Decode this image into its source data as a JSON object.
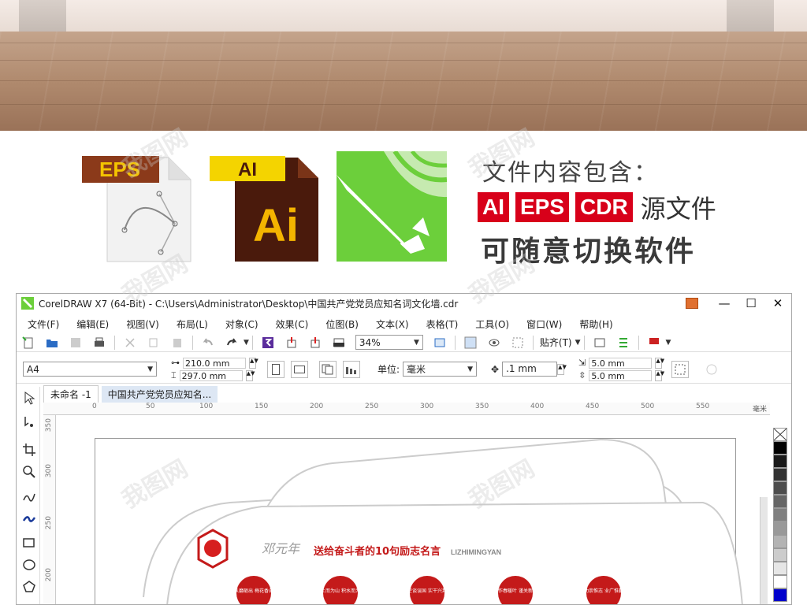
{
  "info": {
    "title": "文件内容包含：",
    "formats": [
      "AI",
      "EPS",
      "CDR"
    ],
    "formats_suffix": "源文件",
    "subtitle": "可随意切换软件",
    "eps_icon_label": "EPS",
    "ai_icon_tab": "AI",
    "ai_icon_main": "Ai"
  },
  "window": {
    "title": "CorelDRAW X7 (64-Bit) - C:\\Users\\Administrator\\Desktop\\中国共产党党员应知名词文化墙.cdr",
    "controls": {
      "minimize": "—",
      "maximize": "☐",
      "close": "✕"
    }
  },
  "menu": [
    "文件(F)",
    "编辑(E)",
    "视图(V)",
    "布局(L)",
    "对象(C)",
    "效果(C)",
    "位图(B)",
    "文本(X)",
    "表格(T)",
    "工具(O)",
    "窗口(W)",
    "帮助(H)"
  ],
  "toolbar": {
    "zoom": "34%",
    "snap_label": "贴齐(T)"
  },
  "property_bar": {
    "page_size": "A4",
    "width": "210.0 mm",
    "height": "297.0 mm",
    "unit_label": "单位:",
    "unit_value": "毫米",
    "nudge": ".1 mm",
    "dup_x": "5.0 mm",
    "dup_y": "5.0 mm"
  },
  "doc_tabs": [
    "未命名 -1",
    "中国共产党党员应知名..."
  ],
  "ruler": {
    "h_ticks": [
      "0",
      "50",
      "100",
      "150",
      "200",
      "250",
      "300",
      "350",
      "400",
      "450",
      "500",
      "550"
    ],
    "h_unit": "毫米",
    "v_ticks": [
      "350",
      "300",
      "250",
      "200"
    ]
  },
  "artwork": {
    "headline": "送给奋斗者的10句励志名言",
    "headline_en": "LIZHIMINGYAN",
    "calligraphy": "邓元年",
    "circles": [
      "宝剑锋从磨砺出 梅花香自苦寒来",
      "积土而为山 积水而为海",
      "空谈误国 实干兴邦",
      "苦耕勤作春暖叶 谨关新进步月",
      "功崇惟志 业广惟勤"
    ]
  },
  "watermark": "我图网",
  "colors": {
    "corel_green": "#6ccf3b",
    "badge_red": "#d8001a",
    "eps_brown": "#8b3a1a",
    "ai_dark": "#4a1a0c",
    "ai_gold": "#f4b400"
  },
  "palette": [
    "#000000",
    "#1a1a1a",
    "#333333",
    "#4d4d4d",
    "#666666",
    "#808080",
    "#999999",
    "#b3b3b3",
    "#cccccc",
    "#e6e6e6",
    "#ffffff",
    "#0000cc"
  ]
}
